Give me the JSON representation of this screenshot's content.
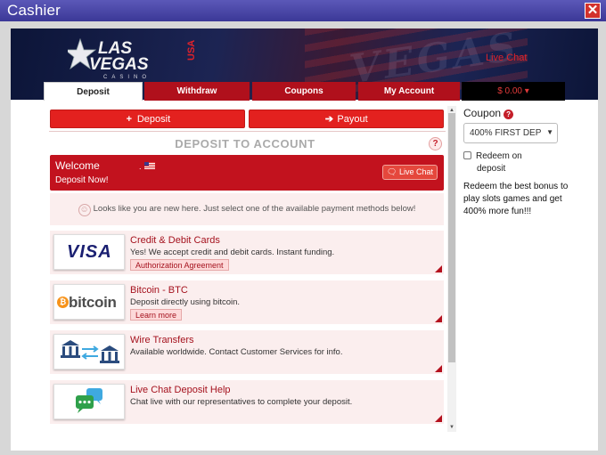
{
  "window": {
    "title": "Cashier",
    "close_symbol": "✕"
  },
  "header": {
    "logo_line1": "LAS",
    "logo_line2": "VEGAS",
    "logo_sub": "CASINO",
    "logo_badge": "USA",
    "live_chat": "Live Chat"
  },
  "tabs": [
    {
      "label": "Deposit",
      "active": true
    },
    {
      "label": "Withdraw",
      "active": false
    },
    {
      "label": "Coupons",
      "active": false
    },
    {
      "label": "My Account",
      "active": false
    },
    {
      "label": "$ 0.00 ▾",
      "active": false
    }
  ],
  "actions": {
    "deposit_label": "Deposit",
    "payout_label": "Payout"
  },
  "deposit_heading": "DEPOSIT TO ACCOUNT",
  "help_symbol": "?",
  "welcome": {
    "greeting": "Welcome",
    "subtitle": "Deposit Now!",
    "live_chat_button": "Live Chat"
  },
  "notice": "Looks like you are new here. Just select one of the available payment methods below!",
  "methods": [
    {
      "icon": "visa-icon",
      "logo_text": "VISA",
      "title": "Credit & Debit Cards",
      "description": "Yes! We accept credit and debit cards. Instant funding.",
      "link": "Authorization Agreement"
    },
    {
      "icon": "bitcoin-icon",
      "logo_text": "bitcoin",
      "title": "Bitcoin - BTC",
      "description": "Deposit directly using bitcoin.",
      "link": "Learn more"
    },
    {
      "icon": "bank-transfer-icon",
      "title": "Wire Transfers",
      "description": "Available worldwide. Contact Customer Services for info."
    },
    {
      "icon": "chat-bubbles-icon",
      "title": "Live Chat Deposit Help",
      "description": "Chat live with our representatives to complete your deposit."
    }
  ],
  "sidebar": {
    "coupon_label": "Coupon",
    "coupon_selected": "400% FIRST DEP",
    "redeem_line1": "Redeem on",
    "redeem_line2": "deposit",
    "promo_text": "Redeem the best bonus to play slots games and get 400% more fun!!!"
  },
  "colors": {
    "brand_red": "#c2121e",
    "title_bar": "#4a47a8",
    "banner_navy": "#1c2453"
  }
}
